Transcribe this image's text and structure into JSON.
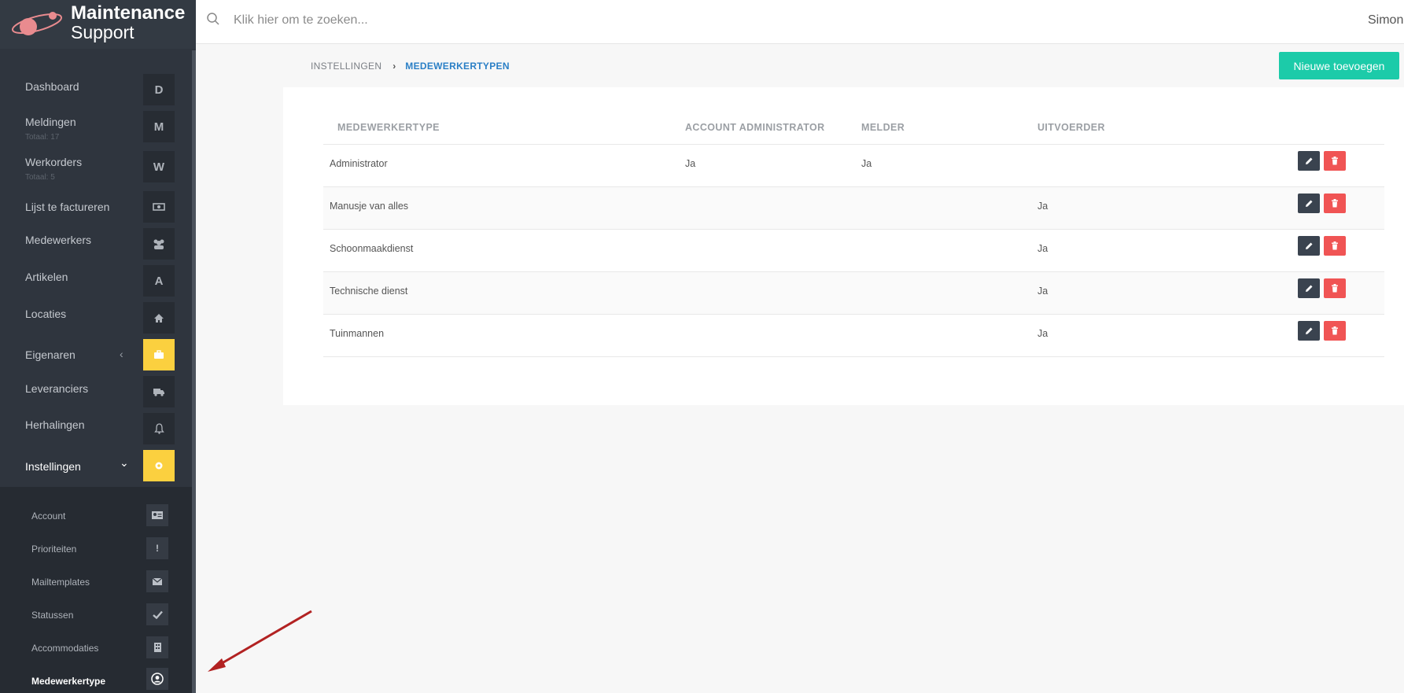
{
  "logo": {
    "title": "Maintenance",
    "subtitle": "Support"
  },
  "sidebar": {
    "items": [
      {
        "label": "Dashboard",
        "badge": "D"
      },
      {
        "label": "Meldingen",
        "sub": "Totaal: 17",
        "badge": "M"
      },
      {
        "label": "Werkorders",
        "sub": "Totaal: 5",
        "badge": "W"
      },
      {
        "label": "Lijst te factureren",
        "icon": "money-icon"
      },
      {
        "label": "Medewerkers",
        "icon": "users-icon"
      },
      {
        "label": "Artikelen",
        "badge": "A"
      },
      {
        "label": "Locaties",
        "icon": "home-icon"
      },
      {
        "label": "Eigenaren",
        "icon": "briefcase-icon",
        "chevron": "‹"
      },
      {
        "label": "Leveranciers",
        "icon": "truck-icon"
      },
      {
        "label": "Herhalingen",
        "icon": "bell-icon"
      },
      {
        "label": "Instellingen",
        "icon": "gear-icon",
        "chevron": "⌄"
      }
    ],
    "submenu": [
      {
        "label": "Account",
        "icon": "id-card-icon"
      },
      {
        "label": "Prioriteiten",
        "icon": "exclamation-icon"
      },
      {
        "label": "Mailtemplates",
        "icon": "envelope-icon"
      },
      {
        "label": "Statussen",
        "icon": "check-icon"
      },
      {
        "label": "Accommodaties",
        "icon": "building-icon"
      },
      {
        "label": "Medewerkertype",
        "icon": "user-circle-icon"
      }
    ]
  },
  "search": {
    "placeholder": "Klik hier om te zoeken..."
  },
  "user": {
    "name": "Simone"
  },
  "breadcrumb": {
    "parent": "INSTELLINGEN",
    "separator": "›",
    "current": "MEDEWERKERTYPEN"
  },
  "actions": {
    "add_label": "Nieuwe toevoegen"
  },
  "table": {
    "headers": [
      "MEDEWERKERTYPE",
      "ACCOUNT ADMINISTRATOR",
      "MELDER",
      "UITVOERDER"
    ],
    "rows": [
      {
        "type": "Administrator",
        "admin": "Ja",
        "melder": "Ja",
        "uitvoerder": ""
      },
      {
        "type": "Manusje van alles",
        "admin": "",
        "melder": "",
        "uitvoerder": "Ja"
      },
      {
        "type": "Schoonmaakdienst",
        "admin": "",
        "melder": "",
        "uitvoerder": "Ja"
      },
      {
        "type": "Technische dienst",
        "admin": "",
        "melder": "",
        "uitvoerder": "Ja"
      },
      {
        "type": "Tuinmannen",
        "admin": "",
        "melder": "",
        "uitvoerder": "Ja"
      }
    ]
  },
  "colors": {
    "accent": "#1ccba9",
    "active_badge": "#fbd03f",
    "delete": "#f05454",
    "edit": "#3a434f",
    "link": "#2a7fc6"
  }
}
